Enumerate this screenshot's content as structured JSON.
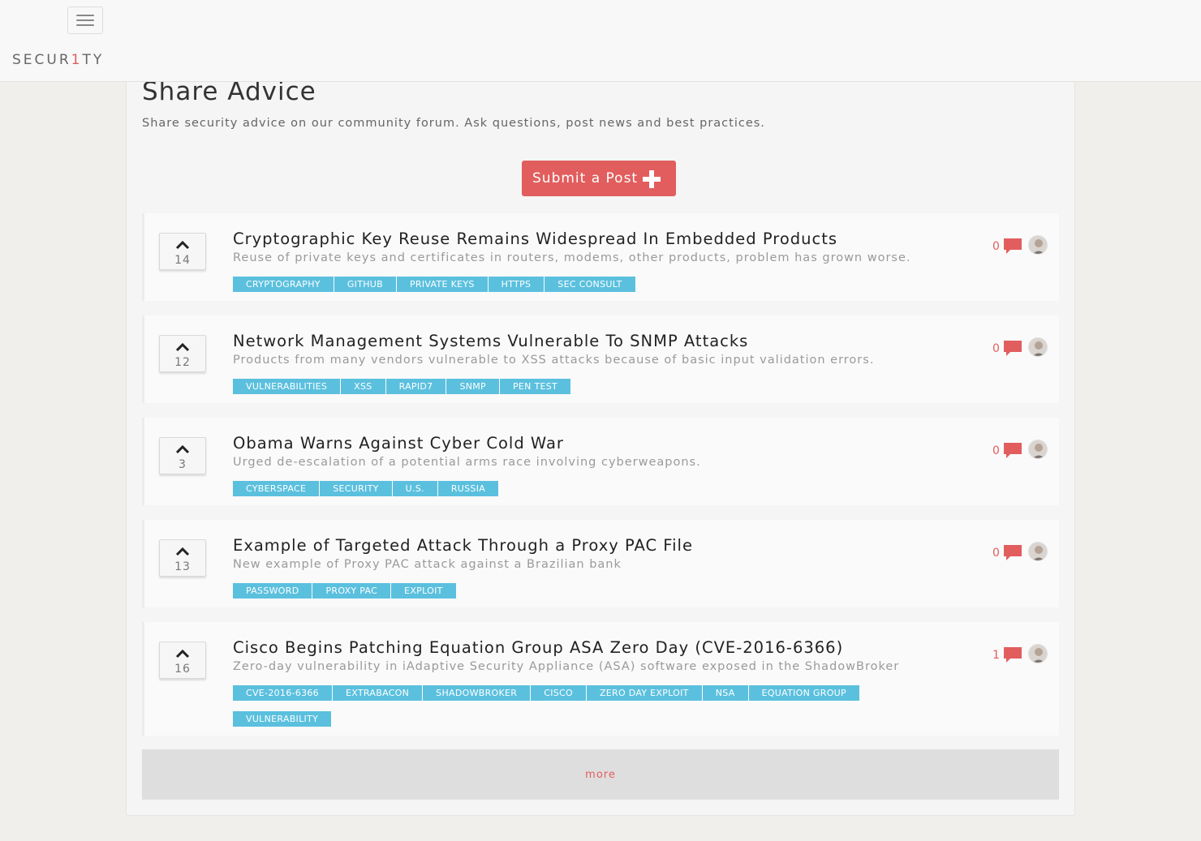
{
  "brand": {
    "prefix": "SECUR",
    "accent": "1",
    "suffix": "TY",
    "accent_color": "#e25d5d"
  },
  "header": {
    "title": "Share Advice",
    "subtitle": "Share security advice on our community forum. Ask questions, post news and best practices."
  },
  "submit_label": "Submit a Post",
  "posts": [
    {
      "votes": "14",
      "title": "Cryptographic Key Reuse Remains Widespread In Embedded Products",
      "desc": "Reuse of private keys and certificates in routers, modems, other products, problem has grown worse.",
      "tags": [
        "CRYPTOGRAPHY",
        "GITHUB",
        "PRIVATE KEYS",
        "HTTPS",
        "SEC CONSULT"
      ],
      "comments": "0"
    },
    {
      "votes": "12",
      "title": "Network Management Systems Vulnerable To SNMP Attacks",
      "desc": "Products from many vendors vulnerable to XSS attacks because of basic input validation errors.",
      "tags": [
        "VULNERABILITIES",
        "XSS",
        "RAPID7",
        "SNMP",
        "PEN TEST"
      ],
      "comments": "0"
    },
    {
      "votes": "3",
      "title": "Obama Warns Against Cyber Cold War",
      "desc": "Urged de-escalation of a potential arms race involving cyberweapons.",
      "tags": [
        "CYBERSPACE",
        "SECURITY",
        "U.S.",
        "RUSSIA"
      ],
      "comments": "0"
    },
    {
      "votes": "13",
      "title": "Example of Targeted Attack Through a Proxy PAC File",
      "desc": "New example of Proxy PAC attack against a Brazilian bank",
      "tags": [
        "PASSWORD",
        "PROXY PAC",
        "EXPLOIT"
      ],
      "comments": "0"
    },
    {
      "votes": "16",
      "title": "Cisco Begins Patching Equation Group ASA Zero Day (CVE-2016-6366)",
      "desc": "Zero-day vulnerability in iAdaptive Security Appliance (ASA) software exposed in the ShadowBroker",
      "tags": [
        "CVE-2016-6366",
        "EXTRABACON",
        "SHADOWBROKER",
        "CISCO",
        "ZERO DAY EXPLOIT",
        "NSA",
        "EQUATION GROUP",
        "VULNERABILITY"
      ],
      "comments": "1"
    }
  ],
  "more_label": "more",
  "colors": {
    "accent": "#e25d5d",
    "tag": "#5bc0de"
  },
  "icons": {
    "menu": "hamburger-menu-icon",
    "plus": "plus-icon",
    "upvote": "chevron-up-icon",
    "comment": "comment-icon",
    "avatar": "user-avatar-icon"
  }
}
